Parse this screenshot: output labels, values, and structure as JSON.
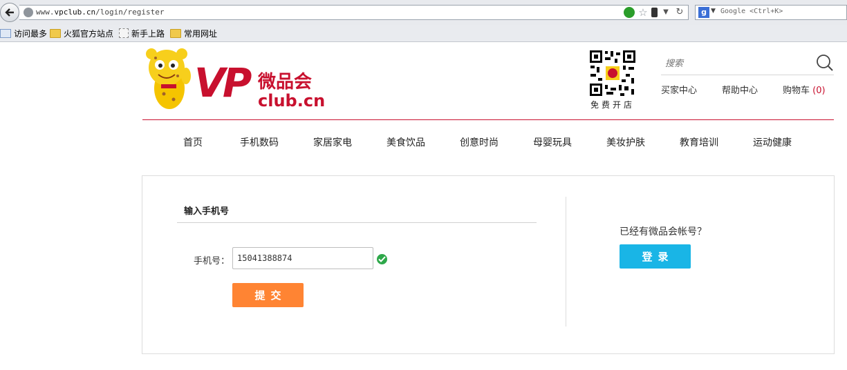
{
  "browser": {
    "url_prefix": "www.",
    "url_domain": "vpclub.cn",
    "url_path": "/login/register",
    "search_engine_glyph": "g",
    "search_placeholder": "Google <Ctrl+K>",
    "bookmarks": [
      {
        "label": "访问最多",
        "icon": "most-visited-icon"
      },
      {
        "label": "火狐官方站点",
        "icon": "folder-icon"
      },
      {
        "label": "新手上路",
        "icon": "page-icon"
      },
      {
        "label": "常用网址",
        "icon": "folder-icon"
      }
    ]
  },
  "header": {
    "logo_letters": "VP",
    "logo_brand": "微品会",
    "logo_domain": "club.cn",
    "qr_caption": "免费开店",
    "search_placeholder": "搜索",
    "links": {
      "buyer": "买家中心",
      "help": "帮助中心",
      "cart": "购物车",
      "cart_count": "(0)"
    }
  },
  "nav": [
    "首页",
    "手机数码",
    "家居家电",
    "美食饮品",
    "创意时尚",
    "母婴玩具",
    "美妆护肤",
    "教育培训",
    "运动健康"
  ],
  "form": {
    "title": "输入手机号",
    "phone_label": "手机号：",
    "phone_value": "15041388874",
    "submit_label": "提交"
  },
  "side": {
    "have_account": "已经有微品会帐号？",
    "login_label": "登录"
  },
  "colors": {
    "brand_red": "#c8102e",
    "submit_orange": "#ff8433",
    "login_blue": "#19b5e6",
    "valid_green": "#2ea84a"
  }
}
